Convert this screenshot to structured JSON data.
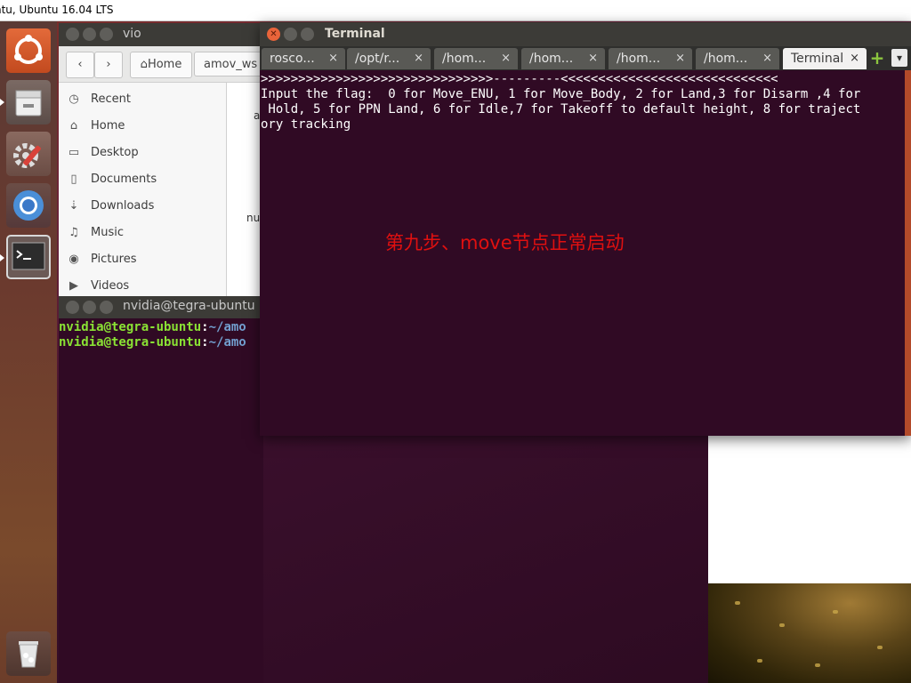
{
  "outer_window": {
    "title": "ntu, Ubuntu 16.04 LTS"
  },
  "file_manager": {
    "title": "vio",
    "toolbar": {
      "back": "‹",
      "forward": "›",
      "home_label": "Home",
      "path_segment": "amov_ws"
    },
    "sidebar": [
      {
        "icon": "clock-icon",
        "label": "Recent"
      },
      {
        "icon": "home-icon",
        "label": "Home"
      },
      {
        "icon": "desktop-icon",
        "label": "Desktop"
      },
      {
        "icon": "document-icon",
        "label": "Documents"
      },
      {
        "icon": "download-icon",
        "label": "Downloads"
      },
      {
        "icon": "music-icon",
        "label": "Music"
      },
      {
        "icon": "camera-icon",
        "label": "Pictures"
      },
      {
        "icon": "video-icon",
        "label": "Videos"
      }
    ],
    "main_fragments": [
      "a",
      "nu"
    ]
  },
  "small_terminal": {
    "title": "nvidia@tegra-ubuntu",
    "lines": [
      {
        "user": "nvidia@tegra-ubuntu",
        "sep": ":",
        "path": "~/amo"
      },
      {
        "user": "nvidia@tegra-ubuntu",
        "sep": ":",
        "path": "~/amo"
      }
    ]
  },
  "terminal": {
    "title": "Terminal",
    "tabs": [
      {
        "label": "rosco...",
        "close": "×"
      },
      {
        "label": "/opt/r...",
        "close": "×"
      },
      {
        "label": "/hom...",
        "close": "×"
      },
      {
        "label": "/hom...",
        "close": "×"
      },
      {
        "label": "/hom...",
        "close": "×"
      },
      {
        "label": "/hom...",
        "close": "×"
      },
      {
        "label": "Terminal",
        "close": "×",
        "active": true
      }
    ],
    "new_tab": "+",
    "tab_menu": "▾",
    "output": [
      ">>>>>>>>>>>>>>>>>>>>>>>>>>>>>>>---------<<<<<<<<<<<<<<<<<<<<<<<<<<<<<",
      "Input the flag:  0 for Move_ENU, 1 for Move_Body, 2 for Land,3 for Disarm ,4 for",
      " Hold, 5 for PPN Land, 6 for Idle,7 for Takeoff to default height, 8 for traject",
      "ory tracking"
    ],
    "annotation": "第九步、move节点正常启动"
  },
  "colors": {
    "terminal_bg": "#300a24",
    "title_bar": "#3c3b37",
    "close_button": "#e9643a",
    "prompt_user": "#8ae234",
    "prompt_path": "#729fcf",
    "annotation": "#e01010"
  }
}
